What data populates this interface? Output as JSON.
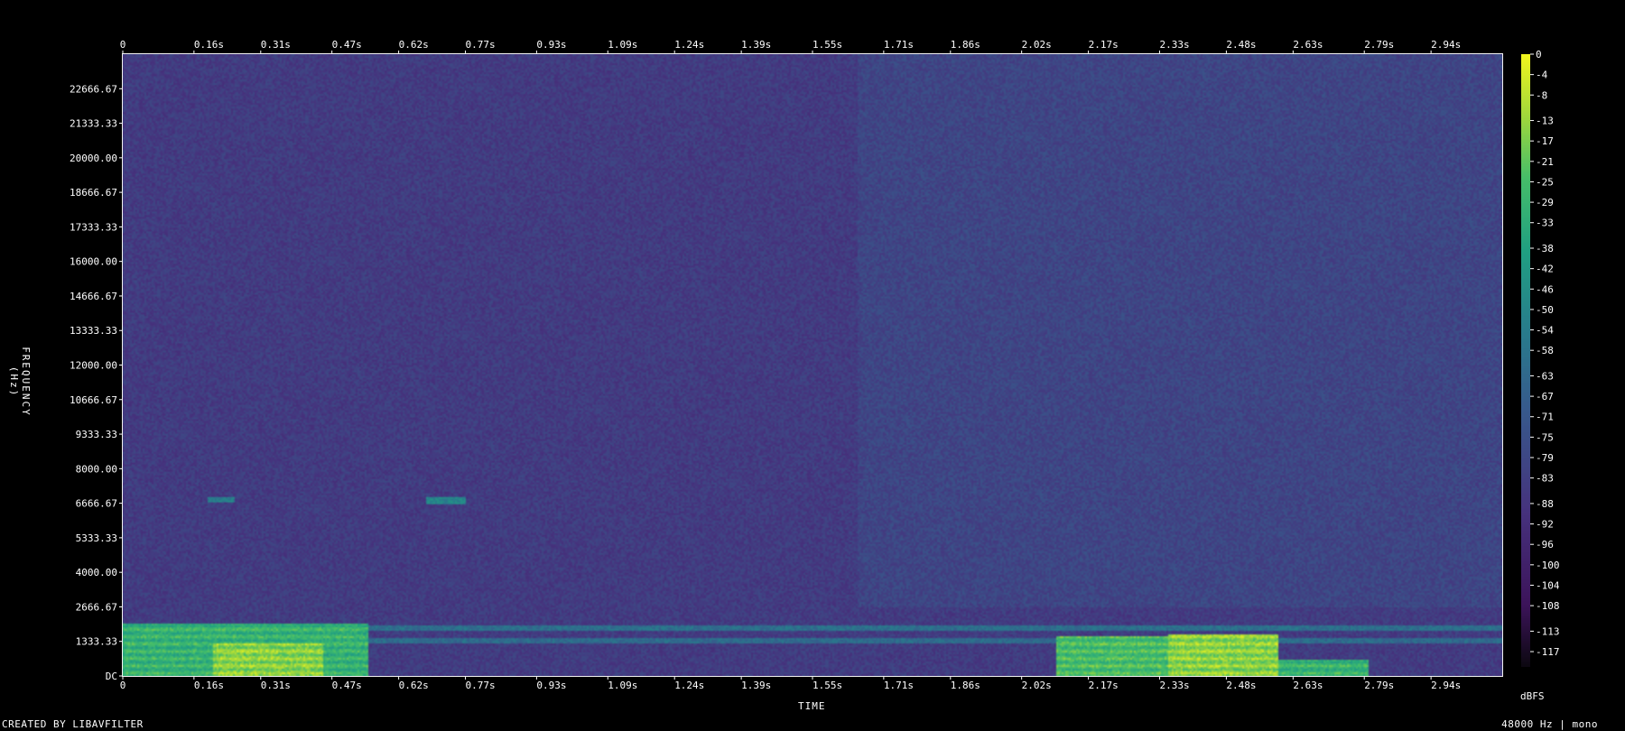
{
  "chart_data": {
    "type": "heatmap",
    "subtype": "spectrogram",
    "x_axis": {
      "label": "TIME",
      "ticks": [
        "0",
        "0.16s",
        "0.31s",
        "0.47s",
        "0.62s",
        "0.77s",
        "0.93s",
        "1.09s",
        "1.24s",
        "1.39s",
        "1.55s",
        "1.71s",
        "1.86s",
        "2.02s",
        "2.17s",
        "2.33s",
        "2.48s",
        "2.63s",
        "2.79s",
        "2.94s"
      ],
      "range_s": [
        0,
        3.1
      ]
    },
    "y_axis": {
      "label": "FREQUENCY (Hz)",
      "ticks": [
        "DC",
        "1333.33",
        "2666.67",
        "4000.00",
        "5333.33",
        "6666.67",
        "8000.00",
        "9333.33",
        "10666.67",
        "12000.00",
        "13333.33",
        "14666.67",
        "16000.00",
        "17333.33",
        "18666.67",
        "20000.00",
        "21333.33",
        "22666.67"
      ],
      "range_hz": [
        0,
        24000
      ]
    },
    "colorbar": {
      "unit": "dBFS",
      "ticks": [
        "0",
        "-4",
        "-8",
        "-13",
        "-17",
        "-21",
        "-25",
        "-29",
        "-33",
        "-38",
        "-42",
        "-46",
        "-50",
        "-54",
        "-58",
        "-63",
        "-67",
        "-71",
        "-75",
        "-79",
        "-83",
        "-88",
        "-92",
        "-96",
        "-100",
        "-104",
        "-108",
        "-113",
        "-117"
      ],
      "range_db": [
        -120,
        0
      ],
      "colormap": "viridis"
    },
    "regions": [
      {
        "t": [
          0.0,
          1.65
        ],
        "f": [
          4000,
          24000
        ],
        "level_db": -92
      },
      {
        "t": [
          0.9,
          1.65
        ],
        "f": [
          2600,
          10000
        ],
        "level_db": -100
      },
      {
        "t": [
          1.65,
          3.1
        ],
        "f": [
          2600,
          24000
        ],
        "level_db": -80
      },
      {
        "t": [
          0.0,
          0.55
        ],
        "f": [
          0,
          2000
        ],
        "level_db": -30
      },
      {
        "t": [
          0.2,
          0.45
        ],
        "f": [
          0,
          1200
        ],
        "level_db": -15
      },
      {
        "t": [
          2.1,
          2.35
        ],
        "f": [
          0,
          1500
        ],
        "level_db": -25
      },
      {
        "t": [
          2.35,
          2.6
        ],
        "f": [
          0,
          1600
        ],
        "level_db": -15
      },
      {
        "t": [
          2.6,
          2.8
        ],
        "f": [
          0,
          600
        ],
        "level_db": -30
      },
      {
        "t": [
          0.0,
          3.1
        ],
        "f": [
          1700,
          1900
        ],
        "level_db": -60
      },
      {
        "t": [
          0.0,
          3.1
        ],
        "f": [
          1250,
          1400
        ],
        "level_db": -62
      },
      {
        "t": [
          0.19,
          0.25
        ],
        "f": [
          6700,
          6900
        ],
        "level_db": -55
      },
      {
        "t": [
          0.68,
          0.77
        ],
        "f": [
          6600,
          6900
        ],
        "level_db": -50
      }
    ]
  },
  "footer": {
    "credit": "CREATED BY LIBAVFILTER",
    "rate": "48000 Hz | mono"
  }
}
